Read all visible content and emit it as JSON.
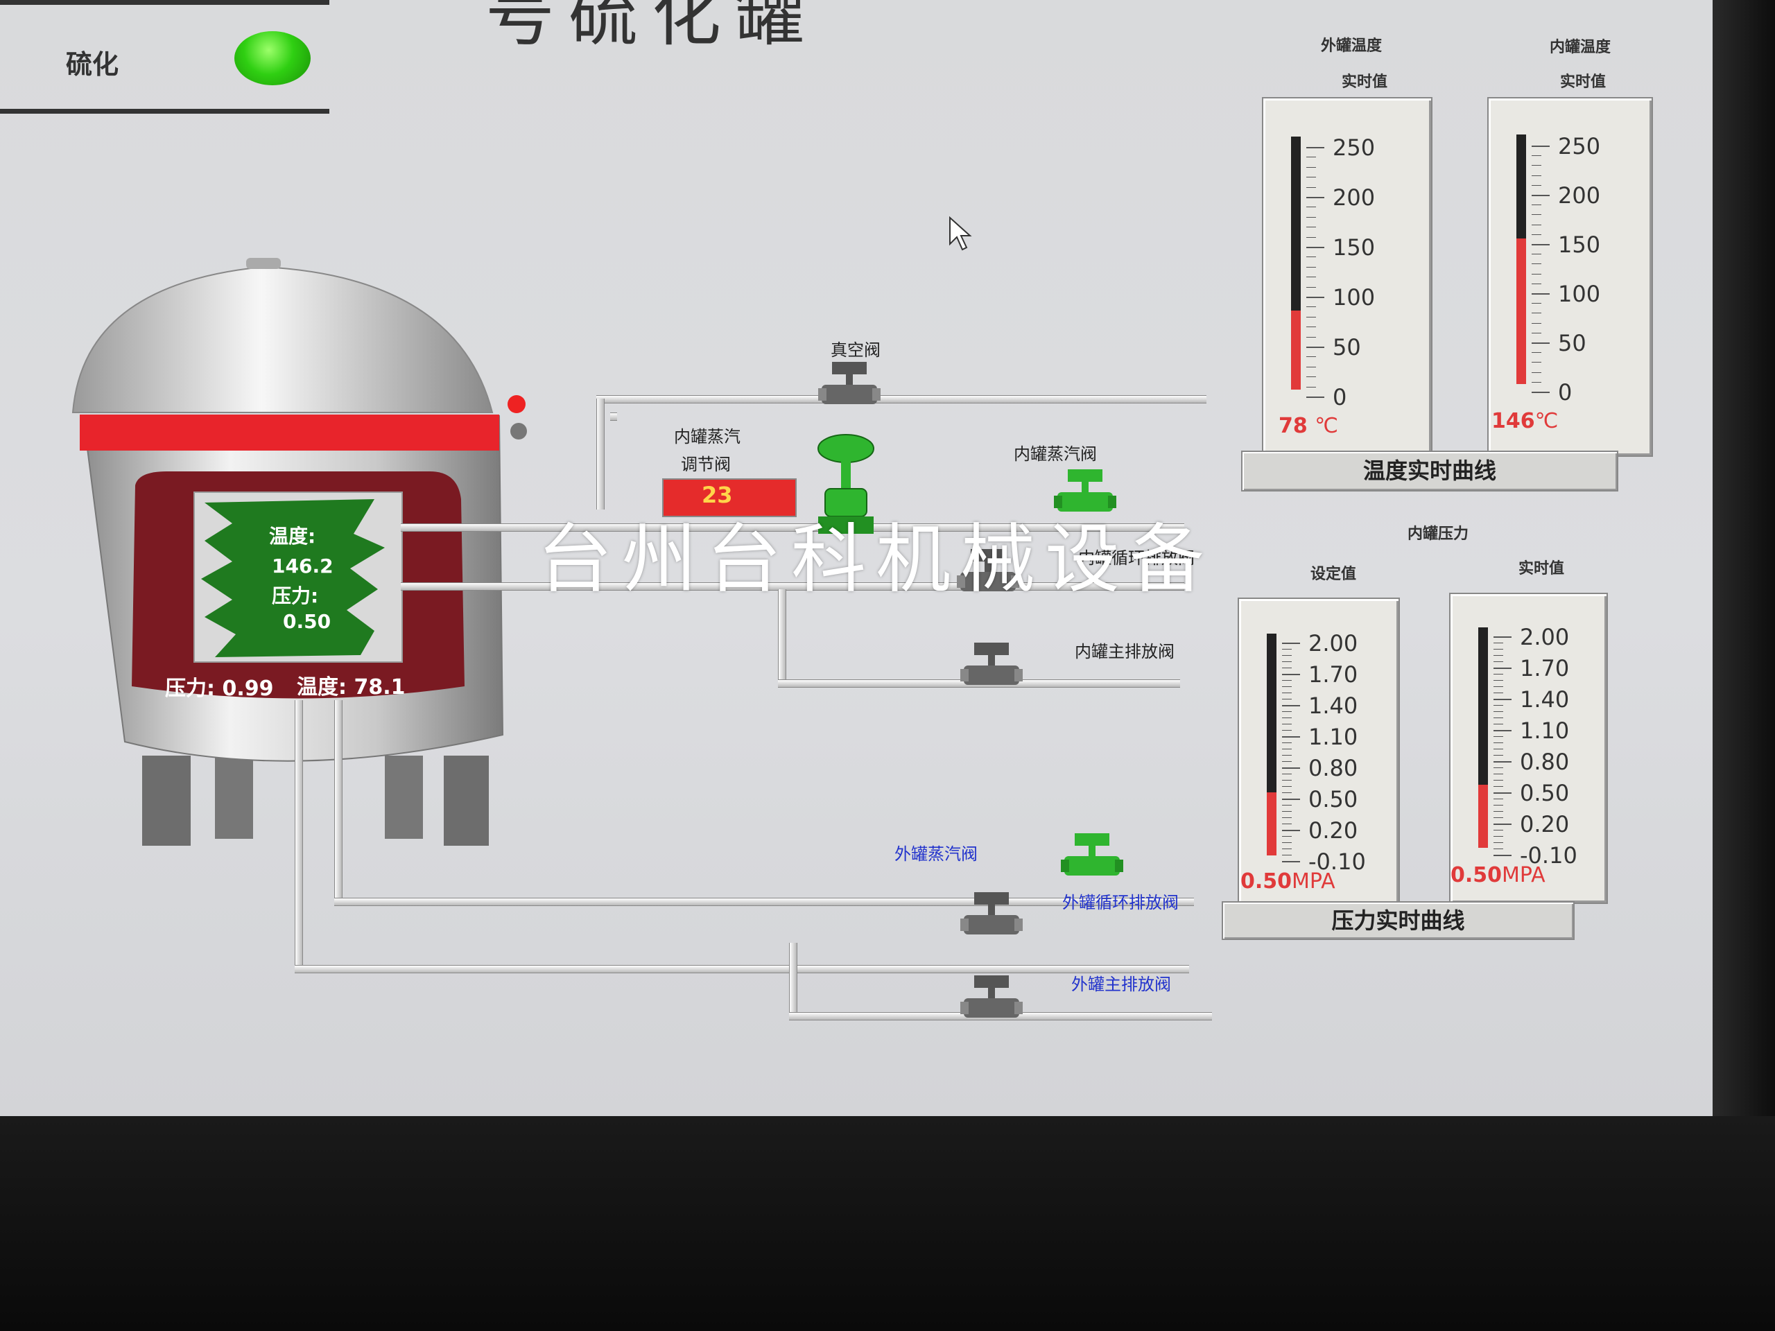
{
  "header": {
    "title_fragment": "号硫化罐"
  },
  "status": {
    "label": "硫化",
    "lamp_color": "#2fcf12"
  },
  "tank": {
    "inner_temp_label": "温度:",
    "inner_temp_value": "146.2",
    "inner_pressure_label": "压力:",
    "inner_pressure_value": "0.50",
    "outer_pressure_text": "压力: 0.99",
    "outer_temp_text": "温度: 78.1"
  },
  "valves": {
    "vacuum": "真空阀",
    "inner_steam_regulator_line1": "内罐蒸汽",
    "inner_steam_regulator_line2": "调节阀",
    "inner_steam_regulator_value": "23",
    "inner_steam": "内罐蒸汽阀",
    "inner_circulation_drain": "内罐循环排放阀",
    "inner_main_drain": "内罐主排放阀",
    "outer_steam": "外罐蒸汽阀",
    "outer_circulation_drain": "外罐循环排放阀",
    "outer_main_drain": "外罐主排放阀"
  },
  "temperature_panel": {
    "outer_head_1": "外罐温度",
    "outer_head_2": "实时值",
    "inner_head_1": "内罐温度",
    "inner_head_2": "实时值",
    "ticks": [
      "250",
      "200",
      "150",
      "100",
      "50",
      "0"
    ],
    "outer_value": 78,
    "inner_value": 146,
    "max": 250,
    "outer_value_text": "78",
    "inner_value_text": "146",
    "unit": "℃",
    "caption": "温度实时曲线"
  },
  "pressure_panel": {
    "head": "内罐压力",
    "set_head": "设定值",
    "real_head": "实时值",
    "ticks": [
      "2.00",
      "1.70",
      "1.40",
      "1.10",
      "0.80",
      "0.50",
      "0.20",
      "-0.10"
    ],
    "min": -0.1,
    "max": 2.0,
    "set_value": 0.5,
    "real_value": 0.5,
    "set_value_text": "0.50",
    "real_value_text": "0.50",
    "unit": "MPA",
    "caption": "压力实时曲线"
  },
  "watermark": "台州台科机械设备",
  "colors": {
    "fill_red": "#e13a3a",
    "valve_green": "#2fb52f",
    "valve_gray": "#555555"
  }
}
